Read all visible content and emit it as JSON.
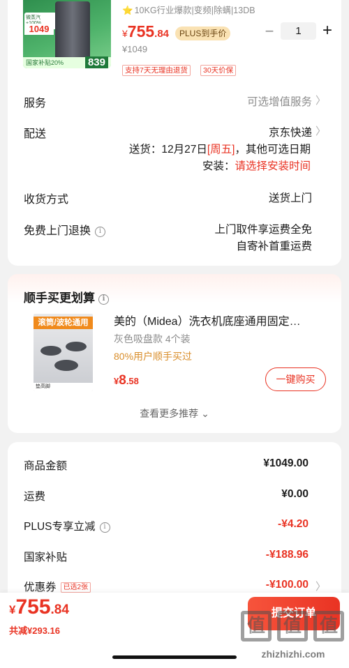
{
  "product": {
    "image": {
      "sticker_text": "微蒸汽+100%",
      "price_tag": "1049",
      "subsidy_text": "国家补贴20%",
      "promo_price": "839"
    },
    "specs": "10KG行业爆款|变频|除螨|13DB",
    "price_symbol": "¥",
    "price_int": "755",
    "price_dec": ".84",
    "plus_badge": "PLUS到手价",
    "original_price": "¥1049",
    "tags": [
      "支持7天无理由退货",
      "30天价保"
    ],
    "quantity": "1",
    "qty_minus": "−",
    "qty_plus": "+"
  },
  "service": {
    "label": "服务",
    "value": "可选增值服务"
  },
  "delivery": {
    "label": "配送",
    "carrier": "京东快递",
    "date_prefix": "送货：",
    "date": "12月27日",
    "weekday": "[周五]",
    "date_suffix": "，其他可选日期",
    "install_label": "安装：",
    "install_value": "请选择安装时间"
  },
  "receive": {
    "label": "收货方式",
    "value": "送货上门"
  },
  "return": {
    "label": "免费上门退换",
    "line1": "上门取件享运费全免",
    "line2": "自寄补首重运费"
  },
  "addon": {
    "title": "顺手买更划算",
    "image_ribbon": "滚筒/波轮通用",
    "image_foot": "垫高脚",
    "name": "美的（Midea）洗衣机底座通用固定…",
    "variant": "灰色吸盘款 4个装",
    "promo": "80%用户顺手买过",
    "price_symbol": "¥",
    "price_int": "8",
    "price_dec": ".58",
    "buy_label": "一键购买",
    "more_label": "查看更多推荐 ⌄"
  },
  "summary": {
    "rows": [
      {
        "label": "商品金额",
        "value": "¥1049.00"
      },
      {
        "label": "运费",
        "value": "¥0.00"
      },
      {
        "label": "PLUS专享立减",
        "value": "-¥4.20"
      },
      {
        "label": "国家补贴",
        "value": "-¥188.96"
      },
      {
        "label": "优惠券",
        "badge": "已选2张",
        "value": "-¥100.00"
      }
    ]
  },
  "bottom": {
    "total_symbol": "¥",
    "total_int": "755",
    "total_dec": ".84",
    "saved": "共减¥293.16",
    "submit_label": "提交订单"
  },
  "watermark": {
    "text": "zhizhizhi.com",
    "glyph": "值"
  },
  "colors": {
    "accent": "#e93323",
    "plus_gold": "#fae2b3",
    "promo_orange": "#d98e2b"
  }
}
